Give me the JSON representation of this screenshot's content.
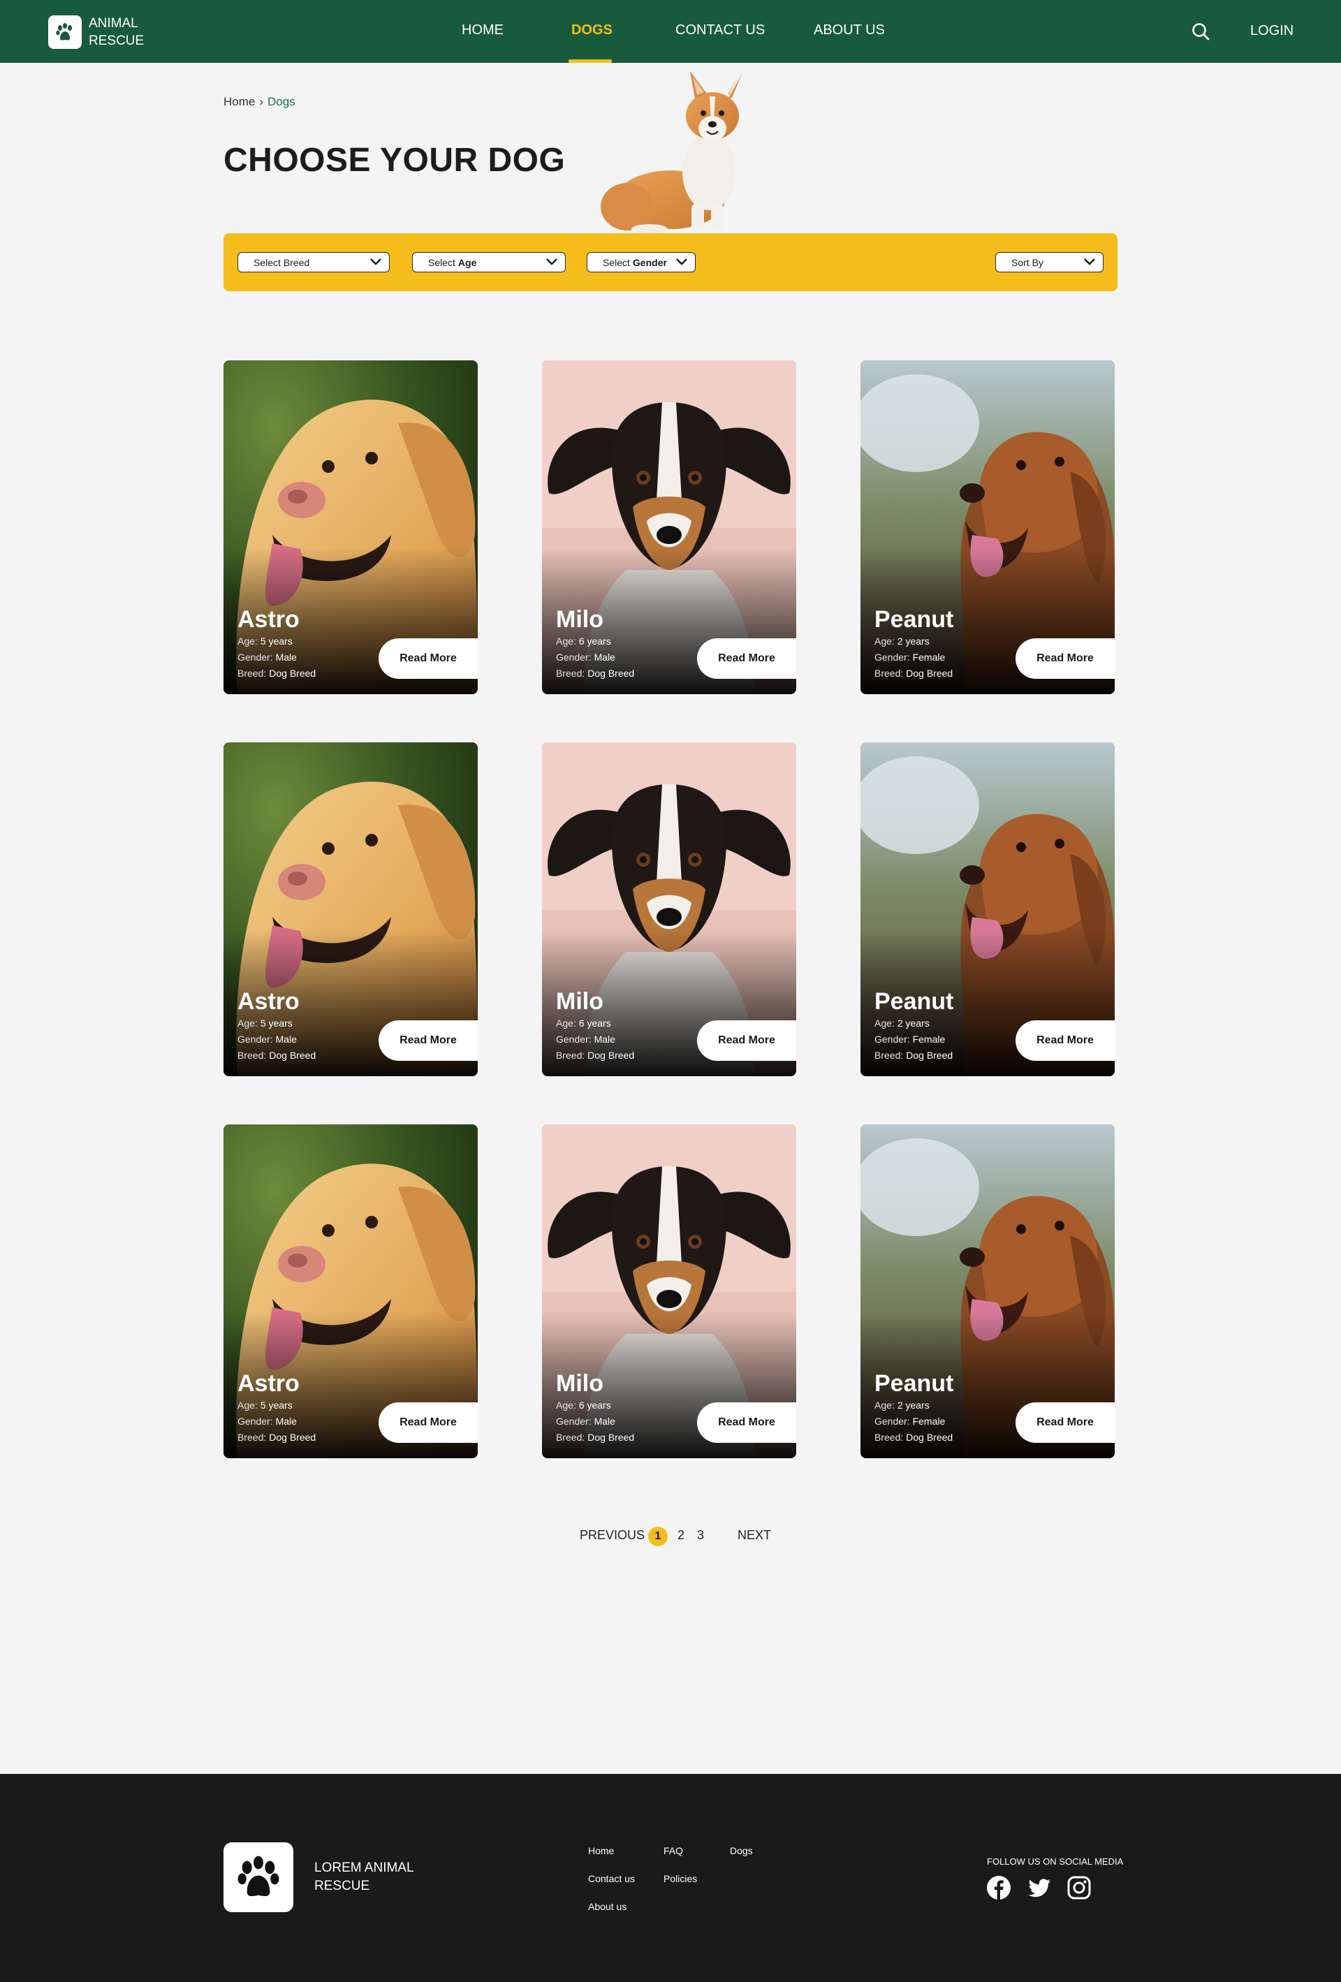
{
  "header": {
    "brand": "ANIMAL RESCUE",
    "nav": [
      "HOME",
      "DOGS",
      "CONTACT US",
      "ABOUT US"
    ],
    "active_nav": "DOGS",
    "login": "LOGIN"
  },
  "breadcrumb": {
    "home": "Home",
    "separator": "›",
    "current": "Dogs"
  },
  "page_title": "CHOOSE YOUR DOG",
  "filters": {
    "breed": {
      "prefix": "Select",
      "label": "Breed"
    },
    "age": {
      "prefix": "Select",
      "label": "Age"
    },
    "gender": {
      "prefix": "Select",
      "label": "Gender"
    },
    "sort": "Sort By"
  },
  "labels": {
    "age": "Age:",
    "gender": "Gender:",
    "breed": "Breed:",
    "read_more": "Read More"
  },
  "dogs": [
    {
      "name": "Astro",
      "age": "5 years",
      "gender": "Male",
      "breed": "Dog Breed"
    },
    {
      "name": "Milo",
      "age": "6 years",
      "gender": "Male",
      "breed": "Dog Breed"
    },
    {
      "name": "Peanut",
      "age": "2 years",
      "gender": "Female",
      "breed": "Dog Breed"
    },
    {
      "name": "Astro",
      "age": "5 years",
      "gender": "Male",
      "breed": "Dog Breed"
    },
    {
      "name": "Milo",
      "age": "6 years",
      "gender": "Male",
      "breed": "Dog Breed"
    },
    {
      "name": "Peanut",
      "age": "2 years",
      "gender": "Female",
      "breed": "Dog Breed"
    },
    {
      "name": "Astro",
      "age": "5 years",
      "gender": "Male",
      "breed": "Dog Breed"
    },
    {
      "name": "Milo",
      "age": "6 years",
      "gender": "Male",
      "breed": "Dog Breed"
    },
    {
      "name": "Peanut",
      "age": "2 years",
      "gender": "Female",
      "breed": "Dog Breed"
    }
  ],
  "pagination": {
    "previous": "PREVIOUS",
    "pages": [
      "1",
      "2",
      "3"
    ],
    "current": "1",
    "next": "NEXT"
  },
  "footer": {
    "brand": "LOREM ANIMAL RESCUE",
    "links": [
      "Home",
      "FAQ",
      "Dogs",
      "Contact us",
      "Policies",
      "About us"
    ],
    "follow": "FOLLOW US ON SOCIAL MEDIA",
    "social": [
      "facebook-icon",
      "twitter-icon",
      "instagram-icon"
    ]
  },
  "colors": {
    "header_green": "#185a3c",
    "accent_yellow": "#f4bd1b",
    "footer_dark": "#1a1a1a"
  }
}
